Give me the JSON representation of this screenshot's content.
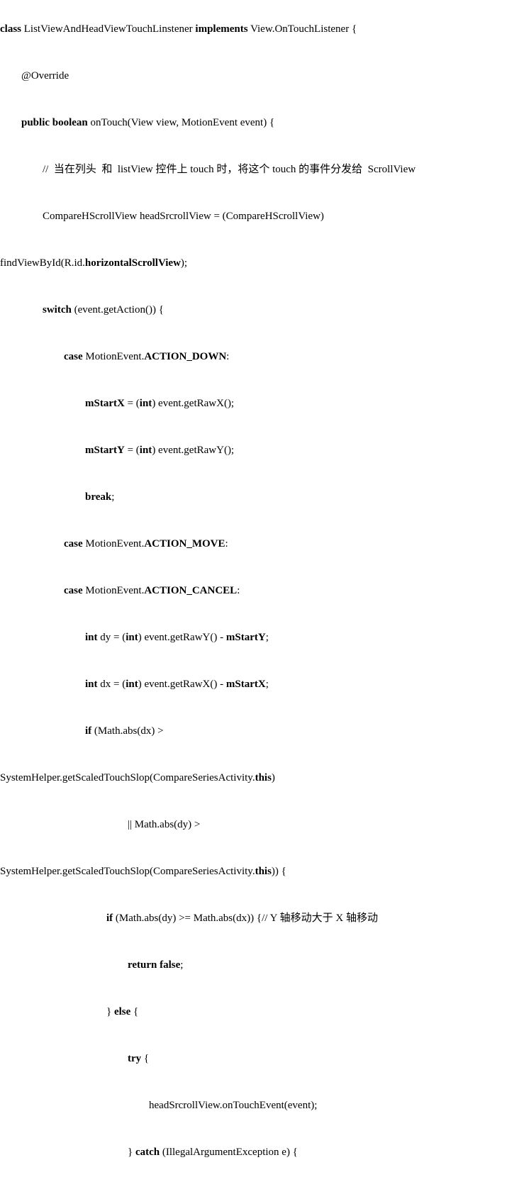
{
  "code": {
    "line1": {
      "pre": "class",
      "plain1": " ListViewAndHeadViewTouchLinstener ",
      "mid": "implements",
      "plain2": " View.OnTouchListener {"
    },
    "line2": "@Override",
    "line3": {
      "pre": "        public boolean",
      "plain": " onTouch(View view, MotionEvent event) {"
    },
    "line4": "                //  当在列头  和  listView 控件上 touch 时，将这个 touch 的事件分发给  ScrollView",
    "line5": "                CompareHScrollView headSrcrollView = (CompareHScrollView)",
    "line6": {
      "plain1": "findViewById(R.id.",
      "bold": "horizontalScrollView",
      "plain2": ");"
    },
    "line7": {
      "pre": "                switch",
      "plain": " (event.getAction()) {"
    },
    "line8": {
      "pre": "                        case",
      "plain1": " MotionEvent.",
      "bold": "ACTION_DOWN",
      "plain2": ":"
    },
    "line9": {
      "bold1": "                                mStartX",
      "plain1": " = (",
      "bold2": "int",
      "plain2": ") event.getRawX();"
    },
    "line10": {
      "bold1": "                                mStartY",
      "plain1": " = (",
      "bold2": "int",
      "plain2": ") event.getRawY();"
    },
    "line11": {
      "bold": "                                break",
      "plain": ";"
    },
    "line12": {
      "pre": "                        case",
      "plain1": " MotionEvent.",
      "bold": "ACTION_MOVE",
      "plain2": ":"
    },
    "line13": {
      "pre": "                        case",
      "plain1": " MotionEvent.",
      "bold": "ACTION_CANCEL",
      "plain2": ":"
    },
    "line14": {
      "bold1": "                                int",
      "plain1": " dy = (",
      "bold2": "int",
      "plain2": ") event.getRawY() - ",
      "bold3": "mStartY",
      "plain3": ";"
    },
    "line15": {
      "bold1": "                                int",
      "plain1": " dx = (",
      "bold2": "int",
      "plain2": ") event.getRawX() - ",
      "bold3": "mStartX",
      "plain3": ";"
    },
    "line16": {
      "bold": "                                if",
      "plain": " (Math.abs(dx) >"
    },
    "line17": {
      "plain1": "SystemHelper.getScaledTouchSlop(CompareSeriesActivity.",
      "bold": "this",
      "plain2": ")"
    },
    "line18": "                                                || Math.abs(dy) >",
    "line19": {
      "plain1": "SystemHelper.getScaledTouchSlop(CompareSeriesActivity.",
      "bold": "this",
      "plain2": ")) {"
    },
    "line20": {
      "bold": "                                        if",
      "plain": " (Math.abs(dy) >= Math.abs(dx)) {// Y 轴移动大于 X 轴移动"
    },
    "line21": {
      "bold": "                                                return false",
      "plain": ";"
    },
    "line22": {
      "plain1": "                                        } ",
      "bold": "else",
      "plain2": " {"
    },
    "line23": {
      "bold": "                                                try",
      "plain": " {"
    },
    "line24": "                                                        headSrcrollView.onTouchEvent(event);",
    "line25": {
      "plain1": "                                                } ",
      "bold": "catch",
      "plain2": " (IllegalArgumentException e) {"
    }
  }
}
